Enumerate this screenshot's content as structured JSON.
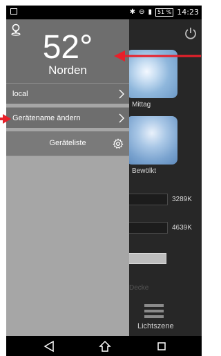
{
  "status_bar": {
    "battery": "51 %",
    "time": "14:23"
  },
  "drawer": {
    "temperature": "52°",
    "direction": "Norden",
    "menu_items": [
      {
        "label": "local"
      },
      {
        "label": "Gerätename ändern"
      }
    ],
    "device_list_label": "Geräteliste"
  },
  "background": {
    "tile1_label": "Mittag",
    "tile2_label": "Bewölkt",
    "bar1_value": "3289K",
    "bar2_value": "4639K",
    "section_label": "Decke",
    "scene_label": "Lichtszene"
  },
  "annotation_color": "#e8202a"
}
